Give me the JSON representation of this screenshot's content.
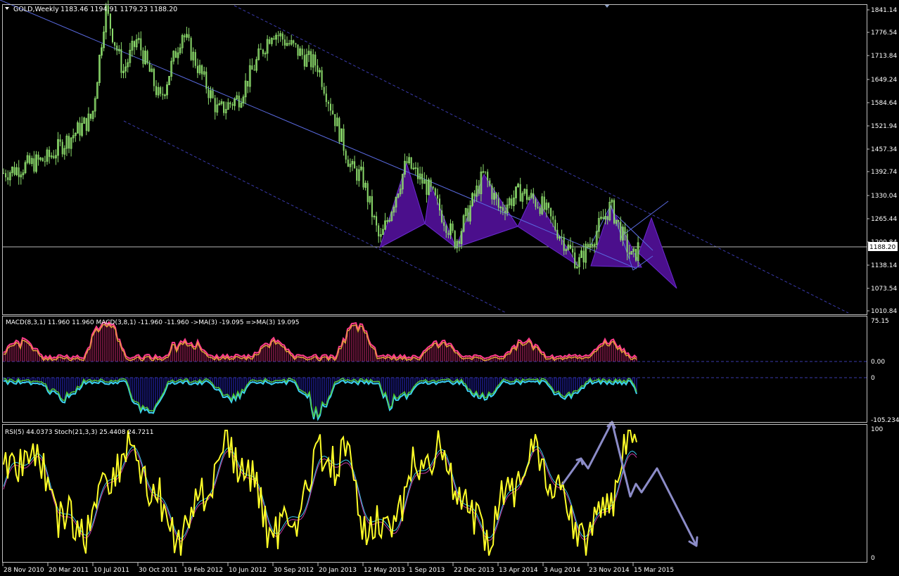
{
  "header": {
    "symbol": "GOLD,Weekly",
    "open": "1183.46",
    "high": "1194.91",
    "low": "1179.23",
    "close": "1188.20",
    "current_price_label": "1188.20"
  },
  "colors": {
    "background": "#000000",
    "frame": "#c0c0c0",
    "bull_candle": "#8cdc6c",
    "pattern_fill": "#4b0f8c",
    "channel": "#3a3aaa",
    "current_line": "#b4b4b4",
    "macd_cyan": "#3cd2f0",
    "macd_green": "#50c83c",
    "macd_pink": "#ff3c8c",
    "macd_orange": "#e6a03c",
    "macd_hist_blue": "#2828c8",
    "macd_hist_red": "#c8286e",
    "rsi_yellow": "#ffff28",
    "stoch_cyan": "#3cc8f0",
    "stoch_magenta": "#c83ca0",
    "arrow": "#8c8cc8"
  },
  "main_price_axis": [
    "1841.14",
    "1776.54",
    "1713.84",
    "1649.24",
    "1584.64",
    "1521.94",
    "1457.34",
    "1392.74",
    "1330.04",
    "1265.44",
    "1200.84",
    "1138.14",
    "1073.54",
    "1010.84"
  ],
  "macd_panel": {
    "label": "MACD(8,3,1) 11.960 11.960  MACD(3,8,1) -11.960 -11.960  ->MA(3) -19.095  =>MA(3) 19.095",
    "axis": [
      "75.15",
      "0.00",
      "0",
      "-105.234"
    ]
  },
  "rsi_panel": {
    "label": "RSI(5) 44.0373  Stoch(21,3,3) 25.4408 24.7211",
    "axis": [
      "100",
      "0"
    ]
  },
  "time_axis": [
    "28 Nov 2010",
    "20 Mar 2011",
    "10 Jul 2011",
    "30 Oct 2011",
    "19 Feb 2012",
    "10 Jun 2012",
    "30 Sep 2012",
    "20 Jan 2013",
    "12 May 2013",
    "1 Sep 2013",
    "22 Dec 2013",
    "13 Apr 2014",
    "3 Aug 2014",
    "23 Nov 2014",
    "15 Mar 2015"
  ],
  "chart_data": {
    "type": "candlestick",
    "timeframe": "Weekly",
    "series": [
      {
        "name": "GOLD,Weekly",
        "anchors": [
          [
            "28 Nov 2010",
            1390
          ],
          [
            "20 Mar 2011",
            1430
          ],
          [
            "10 Jul 2011",
            1545
          ],
          [
            "Aug 2011",
            1845
          ],
          [
            "Sep 2011",
            1670
          ],
          [
            "30 Oct 2011",
            1760
          ],
          [
            "Dec 2011",
            1590
          ],
          [
            "19 Feb 2012",
            1780
          ],
          [
            "May 2012",
            1560
          ],
          [
            "Jul 2012",
            1600
          ],
          [
            "30 Sep 2012",
            1785
          ],
          [
            "Dec 2012",
            1700
          ],
          [
            "20 Jan 2013",
            1690
          ],
          [
            "Apr 2013",
            1400
          ],
          [
            "12 May 2013",
            1380
          ],
          [
            "Jun 2013",
            1200
          ],
          [
            "Aug 2013",
            1420
          ],
          [
            "Sep 2013",
            1340
          ],
          [
            "22 Dec 2013",
            1200
          ],
          [
            "Mar 2014",
            1390
          ],
          [
            "13 Apr 2014",
            1290
          ],
          [
            "Jun 2014",
            1340
          ],
          [
            "3 Aug 2014",
            1300
          ],
          [
            "Nov 2014",
            1140
          ],
          [
            "Jan 2015",
            1300
          ],
          [
            "15 Mar 2015",
            1150
          ],
          [
            "Apr 2015",
            1188
          ]
        ]
      }
    ],
    "last_close": 1188.2,
    "ylim": [
      1010.84,
      1841.14
    ]
  }
}
